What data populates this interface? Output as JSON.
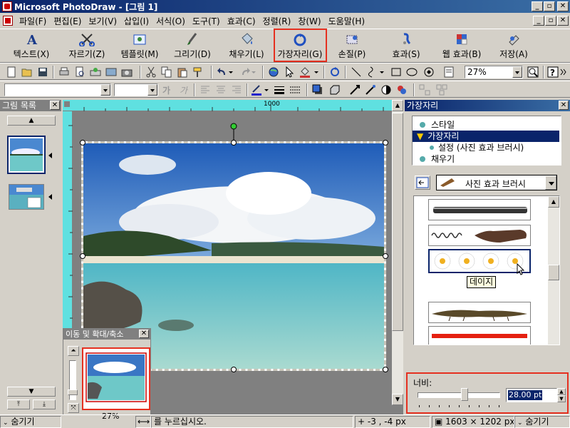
{
  "window": {
    "title": "Microsoft PhotoDraw - [그림 1]"
  },
  "menu": {
    "items": [
      "파일(F)",
      "편집(E)",
      "보기(V)",
      "삽입(I)",
      "서식(O)",
      "도구(T)",
      "효과(C)",
      "정렬(R)",
      "창(W)",
      "도움말(H)"
    ]
  },
  "big_toolbar": {
    "buttons": [
      {
        "label": "텍스트(X)",
        "icon": "text-a-icon"
      },
      {
        "label": "자르기(Z)",
        "icon": "scissors-icon"
      },
      {
        "label": "템플릿(M)",
        "icon": "template-icon"
      },
      {
        "label": "그리기(D)",
        "icon": "draw-brush-icon"
      },
      {
        "label": "채우기(L)",
        "icon": "fill-bucket-icon"
      },
      {
        "label": "가장자리(G)",
        "icon": "edge-swirl-icon"
      },
      {
        "label": "손질(P)",
        "icon": "touchup-icon"
      },
      {
        "label": "효과(S)",
        "icon": "effects-icon"
      },
      {
        "label": "웹 효과(B)",
        "icon": "web-effects-icon"
      },
      {
        "label": "저장(A)",
        "icon": "save-icon"
      }
    ],
    "highlighted": "가장자리(G)"
  },
  "standard_toolbar": {
    "zoom_value": "27%"
  },
  "format_toolbar": {
    "bold_glyph": "가",
    "italic_glyph": "가"
  },
  "picture_list": {
    "title": "그림 목록",
    "hide_label": "숨기기"
  },
  "ruler": {
    "mark_1000": "1000"
  },
  "pan_zoom": {
    "title": "이동 및 확대/축소",
    "zoom": "27%"
  },
  "edge_panel": {
    "title": "가장자리",
    "tree": [
      {
        "label": "스타일",
        "level": 0,
        "selected": false
      },
      {
        "label": "가장자리",
        "level": 0,
        "selected": true
      },
      {
        "label": "설정 (사진 효과 브러시)",
        "level": 1,
        "selected": false
      },
      {
        "label": "채우기",
        "level": 0,
        "selected": false
      }
    ],
    "brush_dropdown": "사진 효과 브러시",
    "tooltip": "데이지",
    "width_label": "너비:",
    "width_value": "28.00 pt",
    "width_fraction": 0.5,
    "hide_label": "숨기기"
  },
  "status": {
    "hint": "를 누르십시오.",
    "coords": "-3 , -4  px",
    "size": "1603 × 1202  px"
  },
  "colors": {
    "title_gradient_start": "#0a246a",
    "title_gradient_end": "#3a6ea5",
    "highlight": "#e53020",
    "selected_tree": "#0a246a"
  }
}
